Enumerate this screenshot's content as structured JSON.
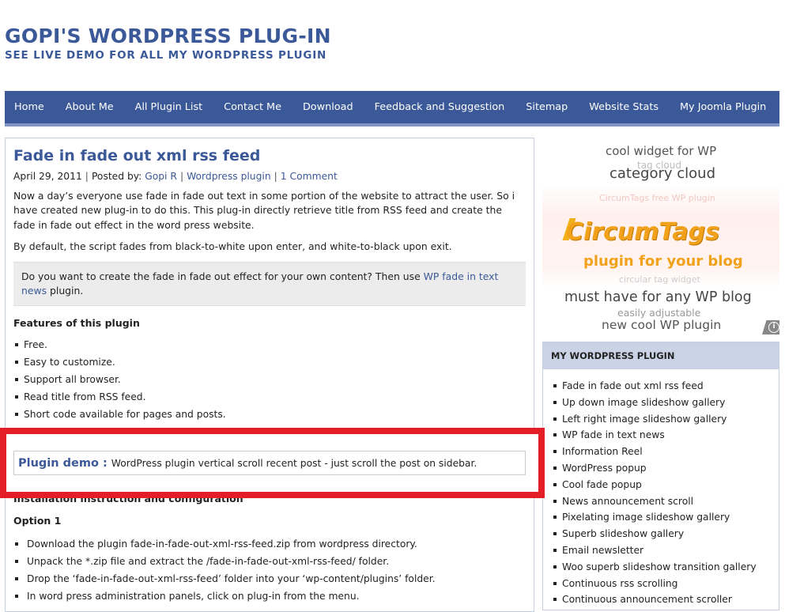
{
  "header": {
    "title": "GOPI'S WORDPRESS PLUG-IN",
    "description": "SEE LIVE DEMO FOR ALL MY WORDPRESS PLUGIN"
  },
  "nav": [
    "Home",
    "About Me",
    "All Plugin List",
    "Contact Me",
    "Download",
    "Feedback and Suggestion",
    "Sitemap",
    "Website Stats",
    "My Joomla Plugin"
  ],
  "post": {
    "title": "Fade in fade out xml rss feed",
    "date": "April 29, 2011",
    "posted_by": "Posted by:",
    "author": "Gopi R",
    "category": "Wordpress plugin",
    "comments": "1 Comment",
    "para1": "Now a day’s everyone use fade in fade out text in some portion of the website to attract the user. So i have created new plug-in to do this. This plug-in directly retrieve title from RSS feed and create the fade in fade out effect in the word press website.",
    "para2": "By default, the script fades from black-to-white upon enter, and white-to-black upon exit.",
    "notice_text": "Do you want to create the fade in fade out effect for your own content? Then use ",
    "notice_link": "WP fade in text news",
    "notice_tail": " plugin.",
    "features_title": "Features of this plugin",
    "features": [
      "Free.",
      "Easy to customize.",
      "Support all browser.",
      "Read title from RSS feed.",
      "Short code available for pages and posts."
    ],
    "demo_label": "Plugin demo :",
    "demo_text": "WordPress plugin vertical scroll recent post - just scroll the post on sidebar.",
    "install_title": "Installation instruction and configuration",
    "option_title": "Option 1",
    "steps": [
      "Download the plugin fade-in-fade-out-xml-rss-feed.zip from wordpress directory.",
      "Unpack the *.zip file and extract the /fade-in-fade-out-xml-rss-feed/ folder.",
      "Drop the ‘fade-in-fade-out-xml-rss-feed’ folder into your ‘wp-content/plugins’ folder.",
      "In word press administration panels, click on plug-in from the menu."
    ]
  },
  "tagcloud": {
    "line1": "cool widget for WP",
    "line2": "tag cloud",
    "line3": "category cloud",
    "line4": "CircumTags  free WP plugin",
    "logo": "CircumTags",
    "tagline": "plugin for your blog",
    "line5": "circular tag widget",
    "line6": "must have for any WP blog",
    "line7": "easily adjustable",
    "line8": "new cool WP plugin",
    "colors": {
      "logo": "#f2a21a",
      "muted": "#bbbbbb",
      "dark": "#555555"
    }
  },
  "sidebar": {
    "heading": "MY WORDPRESS PLUGIN",
    "items": [
      "Fade in fade out xml rss feed",
      "Up down image slideshow gallery",
      "Left right image slideshow gallery",
      "WP fade in text news",
      "Information Reel",
      "WordPress popup",
      "Cool fade popup",
      "News announcement scroll",
      "Pixelating image slideshow gallery",
      "Superb slideshow gallery",
      "Email newsletter",
      "Woo superb slideshow transition gallery",
      "Continuous rss scrolling",
      "Continuous announcement scroller"
    ]
  },
  "colors": {
    "brand": "#3b5998",
    "highlight": "#e41e26"
  }
}
